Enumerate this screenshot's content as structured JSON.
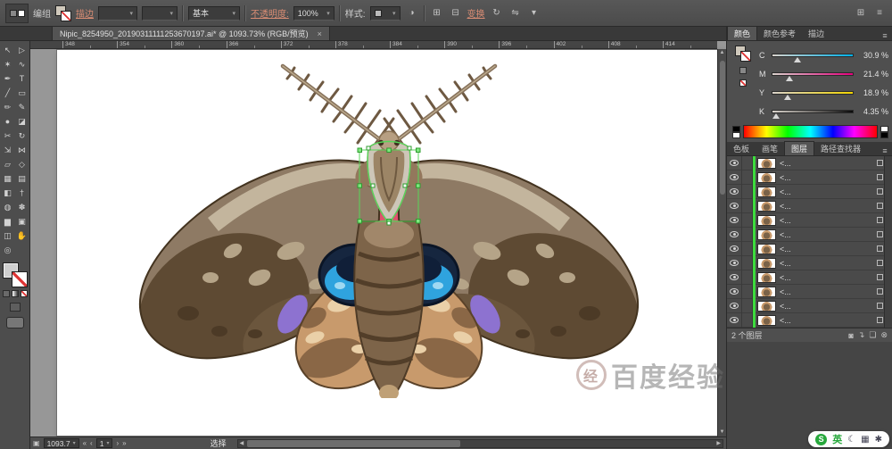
{
  "control_bar": {
    "group_label": "编组",
    "stroke_link": "描边",
    "brush_definition": "基本",
    "opacity_link": "不透明度:",
    "opacity_value": "100%",
    "style_label": "样式:",
    "transform_link": "变换"
  },
  "document_tab": {
    "title": "Nipic_8254950_20190311111253670197.ai* @ 1093.73% (RGB/预览)"
  },
  "ruler": {
    "ticks": [
      "348",
      "354",
      "360",
      "366",
      "372",
      "378",
      "384",
      "390",
      "396",
      "402",
      "408",
      "414"
    ]
  },
  "tools": [
    {
      "name": "selection",
      "glyph": "↖"
    },
    {
      "name": "direct-selection",
      "glyph": "▷"
    },
    {
      "name": "magic-wand",
      "glyph": "✶"
    },
    {
      "name": "lasso",
      "glyph": "∿"
    },
    {
      "name": "pen",
      "glyph": "✒"
    },
    {
      "name": "type",
      "glyph": "T"
    },
    {
      "name": "line-segment",
      "glyph": "╱"
    },
    {
      "name": "rectangle",
      "glyph": "▭"
    },
    {
      "name": "paintbrush",
      "glyph": "✏"
    },
    {
      "name": "pencil",
      "glyph": "✎"
    },
    {
      "name": "blob-brush",
      "glyph": "●"
    },
    {
      "name": "eraser",
      "glyph": "◪"
    },
    {
      "name": "scissors",
      "glyph": "✂"
    },
    {
      "name": "rotate",
      "glyph": "↻"
    },
    {
      "name": "scale",
      "glyph": "⇲"
    },
    {
      "name": "width",
      "glyph": "⋈"
    },
    {
      "name": "free-transform",
      "glyph": "▱"
    },
    {
      "name": "shape-builder",
      "glyph": "◇"
    },
    {
      "name": "perspective-grid",
      "glyph": "▦"
    },
    {
      "name": "mesh",
      "glyph": "▤"
    },
    {
      "name": "gradient",
      "glyph": "◧"
    },
    {
      "name": "eyedropper",
      "glyph": "†"
    },
    {
      "name": "blend",
      "glyph": "◍"
    },
    {
      "name": "symbol-sprayer",
      "glyph": "✽"
    },
    {
      "name": "column-graph",
      "glyph": "▆"
    },
    {
      "name": "artboard",
      "glyph": "▣"
    },
    {
      "name": "slice",
      "glyph": "◫"
    },
    {
      "name": "hand",
      "glyph": "✋"
    },
    {
      "name": "zoom",
      "glyph": "◎"
    }
  ],
  "color_panel": {
    "tabs": [
      "颜色",
      "颜色参考",
      "描边"
    ],
    "channels": [
      {
        "label": "C",
        "value": "30.9 %"
      },
      {
        "label": "M",
        "value": "21.4 %"
      },
      {
        "label": "Y",
        "value": "18.9 %"
      },
      {
        "label": "K",
        "value": "4.35 %"
      }
    ]
  },
  "panel_tabs": {
    "tabs": [
      "色板",
      "画笔",
      "图层",
      "路径查找器"
    ]
  },
  "layers": {
    "rows": [
      {
        "name": "<..."
      },
      {
        "name": "<..."
      },
      {
        "name": "<..."
      },
      {
        "name": "<..."
      },
      {
        "name": "<..."
      },
      {
        "name": "<..."
      },
      {
        "name": "<..."
      },
      {
        "name": "<..."
      },
      {
        "name": "<..."
      },
      {
        "name": "<..."
      },
      {
        "name": "<..."
      },
      {
        "name": "<..."
      }
    ],
    "footer": "2 个图层"
  },
  "status_bar": {
    "zoom": "1093.7",
    "artboard": "1",
    "status": "选择"
  },
  "ime": {
    "logo": "S",
    "mode": "英"
  },
  "watermark": {
    "logo_char": "经",
    "text": "百度经验"
  },
  "icons": {
    "close": "×",
    "dropdown": "▾",
    "panel_menu": "≡",
    "recolor": "◑",
    "align_a": "⊞",
    "align_b": "⊟",
    "rotate": "↻",
    "flip": "⇋",
    "nav_first": "«",
    "nav_prev": "‹",
    "nav_next": "›",
    "nav_last": "»",
    "scroll_left": "◀",
    "scroll_right": "▶",
    "scroll_up": "▲",
    "scroll_down": "▼",
    "mask": "◙",
    "new_sublayer": "↴",
    "new_layer": "❏",
    "delete_layer": "⊗",
    "corner": "▣",
    "moon": "☾",
    "keyboard": "▦",
    "toolbox": "✱"
  }
}
